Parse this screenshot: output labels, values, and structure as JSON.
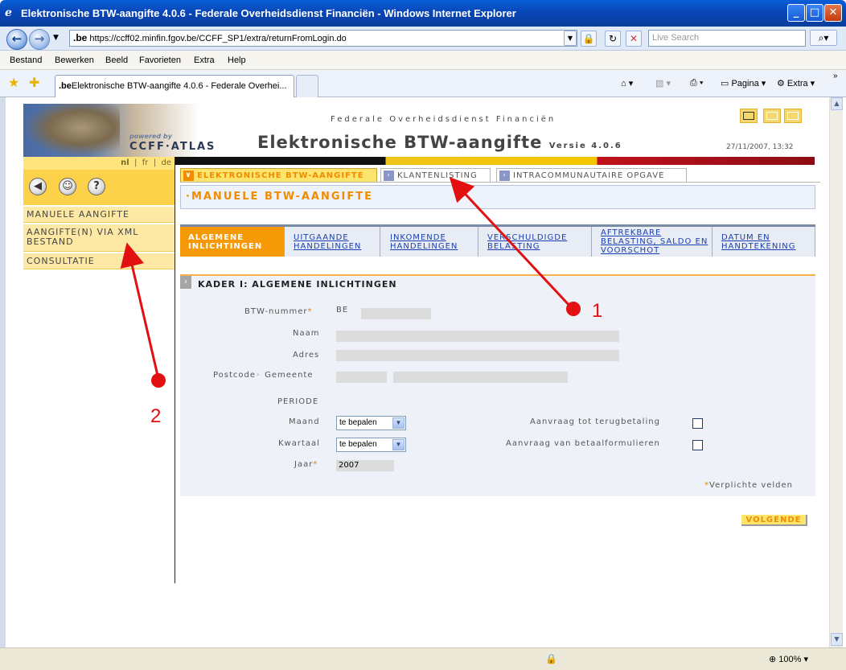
{
  "browser": {
    "window_title": "Elektronische BTW-aangifte 4.0.6 - Federale Overheidsdienst Financiën - Windows Internet Explorer",
    "url_domain": ".be",
    "url": "https://ccff02.minfin.fgov.be/CCFF_SP1/extra/returnFromLogin.do",
    "search_placeholder": "Live Search",
    "menu": [
      "Bestand",
      "Bewerken",
      "Beeld",
      "Favorieten",
      "Extra",
      "Help"
    ],
    "tab_domain": ".be",
    "tab_title": "Elektronische BTW-aangifte 4.0.6 - Federale Overhei...",
    "toolbar_pagina": "Pagina",
    "toolbar_extra": "Extra",
    "zoom": "100%"
  },
  "header": {
    "powered_by": "powered by",
    "brand": "CCFF·ATLAS",
    "agency": "Federale Overheidsdienst Financiën",
    "app_title": "Elektronische BTW-aangifte",
    "version": "Versie 4.0.6",
    "datetime": "27/11/2007, 13:32"
  },
  "sidebar": {
    "languages": [
      "nl",
      "fr",
      "de"
    ],
    "icons": [
      "back-icon",
      "user-icon",
      "help-icon"
    ],
    "items": [
      {
        "label": "MANUELE AANGIFTE"
      },
      {
        "label": "AANGIFTE(N) VIA XML BESTAND"
      },
      {
        "label": "CONSULTATIE"
      }
    ]
  },
  "top_tabs": [
    {
      "label": "ELEKTRONISCHE BTW-AANGIFTE",
      "active": true
    },
    {
      "label": "KLANTENLISTING",
      "active": false
    },
    {
      "label": "INTRACOMMUNAUTAIRE OPGAVE",
      "active": false
    }
  ],
  "section_title": "·MANUELE BTW-AANGIFTE",
  "sub_tabs": [
    {
      "label": "ALGEMENE INLICHTINGEN",
      "active": true
    },
    {
      "label": "UITGAANDE HANDELINGEN",
      "active": false
    },
    {
      "label": "INKOMENDE HANDELINGEN",
      "active": false
    },
    {
      "label": "VERSCHULDIGDE BELASTING",
      "active": false
    },
    {
      "label": "AFTREKBARE BELASTING, SALDO EN VOORSCHOT",
      "active": false
    },
    {
      "label": "DATUM EN HANDTEKENING",
      "active": false
    }
  ],
  "form": {
    "title": "KADER I: ALGEMENE INLICHTINGEN",
    "btw_label": "BTW-nummer",
    "btw_prefix": "BE",
    "naam_label": "Naam",
    "adres_label": "Adres",
    "postcode_label": "Postcode",
    "gemeente_label": "Gemeente",
    "periode_label": "PERIODE",
    "maand_label": "Maand",
    "maand_value": "te bepalen",
    "kwartaal_label": "Kwartaal",
    "kwartaal_value": "te bepalen",
    "jaar_label": "Jaar",
    "jaar_value": "2007",
    "terugbetaling_label": "Aanvraag tot terugbetaling",
    "betaalformulieren_label": "Aanvraag van betaalformulieren",
    "required_note": "Verplichte velden",
    "next_button": "VOLGENDE"
  },
  "annotations": [
    {
      "number": "1"
    },
    {
      "number": "2"
    }
  ],
  "colors": {
    "accent_orange": "#f08c00",
    "tab_yellow": "#fde56d",
    "annotation_red": "#e21010"
  }
}
